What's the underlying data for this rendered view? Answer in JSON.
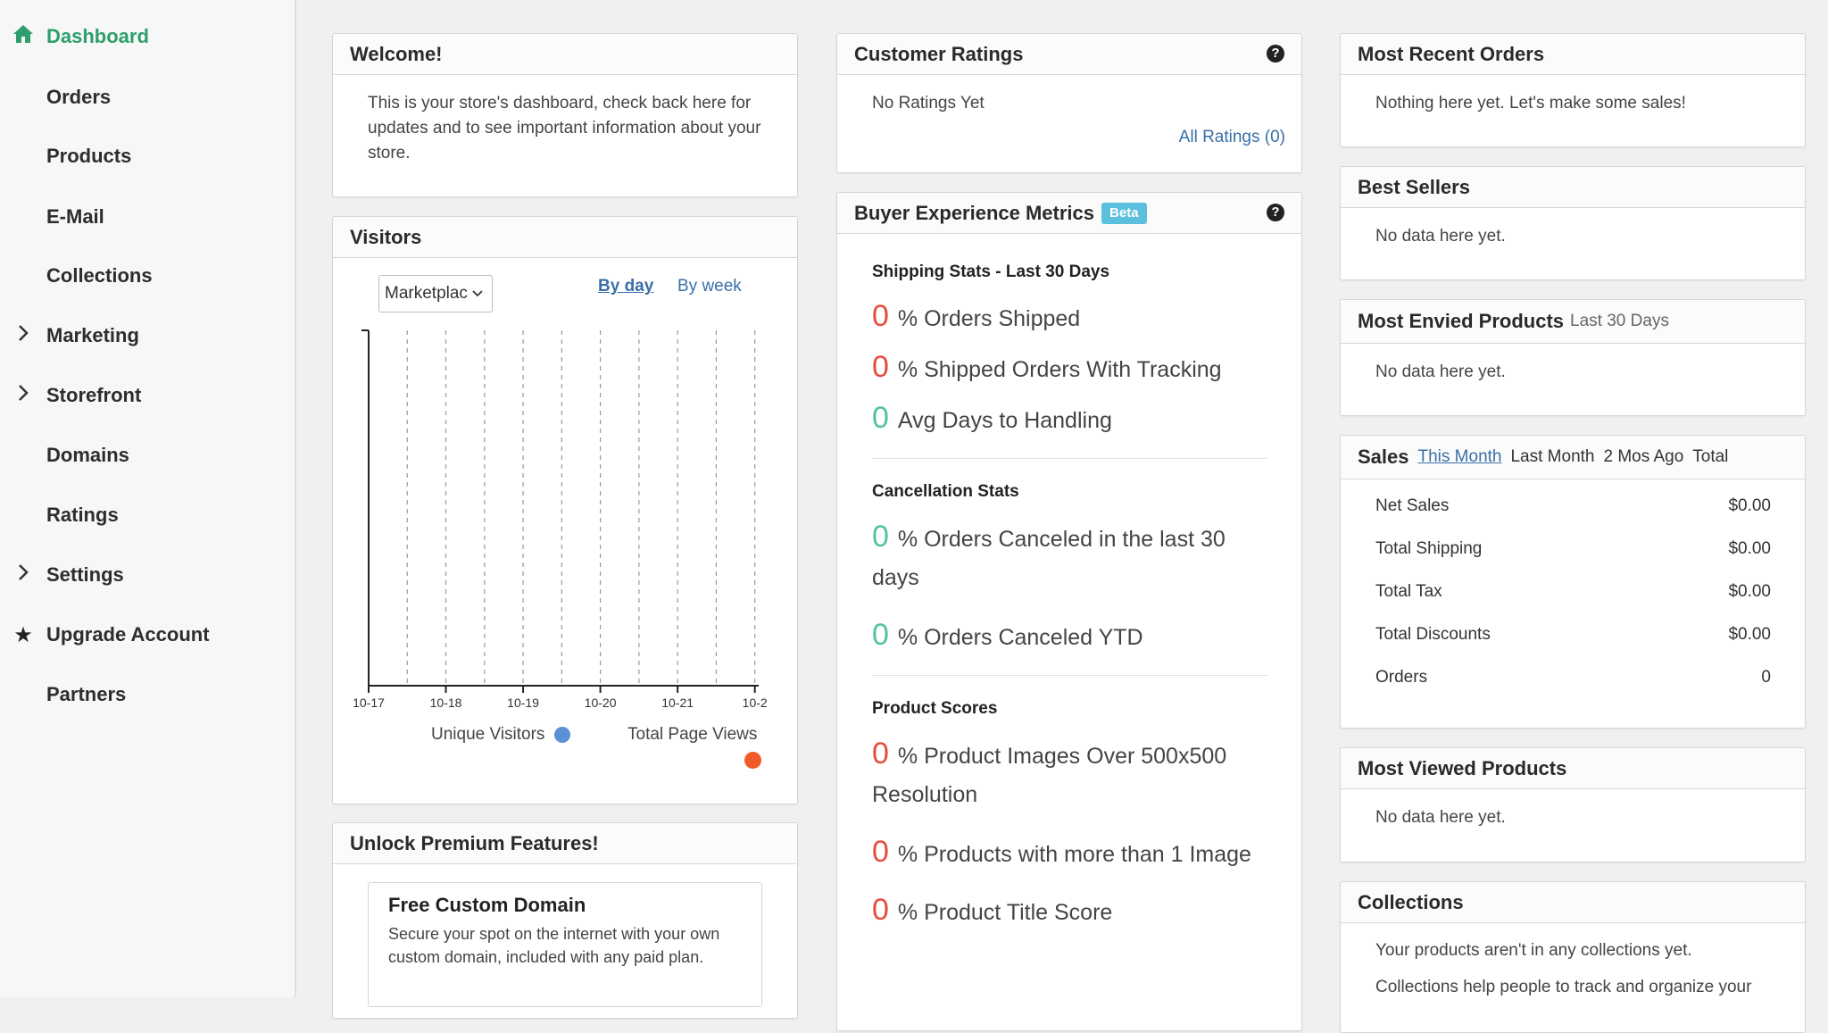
{
  "sidebar": {
    "items": [
      {
        "label": "Dashboard",
        "icon": "home-icon",
        "active": true
      },
      {
        "label": "Orders"
      },
      {
        "label": "Products"
      },
      {
        "label": "E-Mail"
      },
      {
        "label": "Collections"
      },
      {
        "label": "Marketing",
        "icon": "chevron-right-icon"
      },
      {
        "label": "Storefront",
        "icon": "chevron-right-icon"
      },
      {
        "label": "Domains"
      },
      {
        "label": "Ratings"
      },
      {
        "label": "Settings",
        "icon": "chevron-right-icon"
      },
      {
        "label": "Upgrade Account",
        "icon": "star-icon"
      },
      {
        "label": "Partners"
      }
    ]
  },
  "welcome": {
    "title": "Welcome!",
    "text": "This is your store's dashboard, check back here for updates and to see important information about your store."
  },
  "visitors": {
    "title": "Visitors",
    "select_value": "Marketplac",
    "by_day": "By day",
    "by_week": "By week",
    "legend_unique": "Unique Visitors",
    "legend_total": "Total Page Views"
  },
  "chart_data": {
    "type": "line",
    "x": [
      "10-17",
      "10-18",
      "10-19",
      "10-20",
      "10-21",
      "10-2"
    ],
    "series": [
      {
        "name": "Unique Visitors",
        "values": [],
        "color": "#5b8fd6"
      },
      {
        "name": "Total Page Views",
        "values": [],
        "color": "#f05a28"
      }
    ],
    "grid": true
  },
  "premium": {
    "title": "Unlock Premium Features!",
    "card_title": "Free Custom Domain",
    "card_text": "Secure your spot on the internet with your own custom domain, included with any paid plan."
  },
  "ratings": {
    "title": "Customer Ratings",
    "empty": "No Ratings Yet",
    "link": "All Ratings (0)"
  },
  "buyer": {
    "title": "Buyer Experience Metrics",
    "badge": "Beta",
    "shipping_head": "Shipping Stats - Last 30 Days",
    "shipping": [
      {
        "value": "0",
        "label": "% Orders Shipped",
        "color": "red"
      },
      {
        "value": "0",
        "label": "% Shipped Orders With Tracking",
        "color": "red"
      },
      {
        "value": "0",
        "label": "Avg Days to Handling",
        "color": "green"
      }
    ],
    "cancel_head": "Cancellation Stats",
    "cancel": [
      {
        "value": "0",
        "label": "% Orders Canceled in the last 30 days",
        "color": "green"
      },
      {
        "value": "0",
        "label": "% Orders Canceled YTD",
        "color": "green"
      }
    ],
    "product_head": "Product Scores",
    "product": [
      {
        "value": "0",
        "label": "% Product Images Over 500x500 Resolution",
        "color": "red"
      },
      {
        "value": "0",
        "label": "% Products with more than 1 Image",
        "color": "red"
      },
      {
        "value": "0",
        "label": "% Product Title Score",
        "color": "red"
      }
    ]
  },
  "recent_orders": {
    "title": "Most Recent Orders",
    "text": "Nothing here yet. Let's make some sales!"
  },
  "best_sellers": {
    "title": "Best Sellers",
    "text": "No data here yet."
  },
  "envied": {
    "title": "Most Envied Products",
    "subtitle": "Last 30 Days",
    "text": "No data here yet."
  },
  "sales": {
    "title": "Sales",
    "tabs": [
      "This Month",
      "Last Month",
      "2 Mos Ago",
      "Total"
    ],
    "rows": [
      {
        "label": "Net Sales",
        "value": "$0.00"
      },
      {
        "label": "Total Shipping",
        "value": "$0.00"
      },
      {
        "label": "Total Tax",
        "value": "$0.00"
      },
      {
        "label": "Total Discounts",
        "value": "$0.00"
      },
      {
        "label": "Orders",
        "value": "0"
      }
    ]
  },
  "viewed": {
    "title": "Most Viewed Products",
    "text": "No data here yet."
  },
  "collections": {
    "title": "Collections",
    "text1": "Your products aren't in any collections yet.",
    "text2": "Collections help people to track and organize your"
  }
}
